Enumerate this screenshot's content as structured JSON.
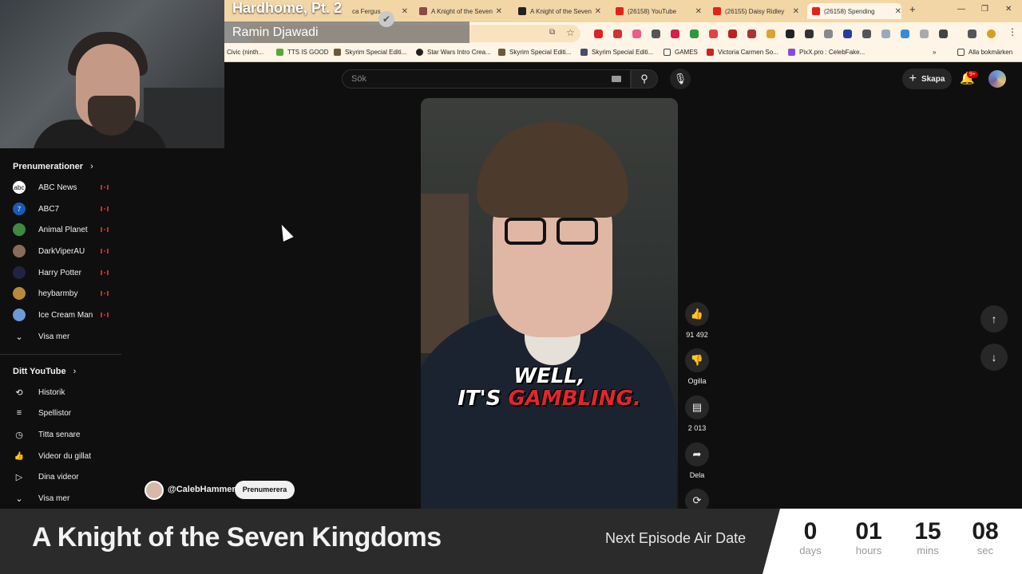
{
  "stream_overlay": {
    "title": "Hardhome, Pt. 2",
    "subtitle": "Ramin Djawadi"
  },
  "browser": {
    "tabs": [
      {
        "label": "ca Fergus"
      },
      {
        "label": "A Knight of the Seven"
      },
      {
        "label": "A Knight of the Seven"
      },
      {
        "label": "(26158) YouTube"
      },
      {
        "label": "(26155) Daisy Ridley"
      },
      {
        "label": "(26158) Spending"
      }
    ],
    "bookmarks": [
      {
        "label": "Civic (ninth..."
      },
      {
        "label": "TTS IS GOOD"
      },
      {
        "label": "Skyrim Special Editi..."
      },
      {
        "label": "Star Wars Intro Crea..."
      },
      {
        "label": "Skyrim Special Editi..."
      },
      {
        "label": "Skyrim Special Editi..."
      },
      {
        "label": "GAMES"
      },
      {
        "label": "Victoria Carmen So..."
      },
      {
        "label": "PixX.pro : CelebFake..."
      },
      {
        "label": "Alla bokmärken"
      }
    ]
  },
  "youtube": {
    "search_placeholder": "Sök",
    "create_label": "Skapa",
    "notif_badge": "9+",
    "subscriptions_heading": "Prenumerationer",
    "subscriptions": [
      {
        "label": "ABC News",
        "color": "#ffffff"
      },
      {
        "label": "ABC7",
        "color": "#1a5bb8"
      },
      {
        "label": "Animal Planet",
        "color": "#3f8a3f"
      },
      {
        "label": "DarkViperAU",
        "color": "#8a6a5a"
      },
      {
        "label": "Harry Potter",
        "color": "#222244"
      },
      {
        "label": "heybarmby",
        "color": "#b88a3a"
      },
      {
        "label": "Ice Cream Man",
        "color": "#6a9ad8"
      }
    ],
    "show_more": "Visa mer",
    "you_heading": "Ditt YouTube",
    "you_items": [
      {
        "label": "Historik",
        "icon": "⟲"
      },
      {
        "label": "Spellistor",
        "icon": "≡"
      },
      {
        "label": "Titta senare",
        "icon": "◷"
      },
      {
        "label": "Videor du gillat",
        "icon": "👍"
      },
      {
        "label": "Dina videor",
        "icon": "▷"
      }
    ],
    "show_more_2": "Visa mer",
    "short": {
      "caption_line1": "WELL,",
      "caption_line2_a": "IT'S ",
      "caption_line2_b": "GAMBLING.",
      "channel": "@CalebHammer",
      "subscribe": "Prenumerera",
      "likes": "91 492",
      "dislike_label": "Ogilla",
      "comments": "2 013",
      "share_label": "Dela"
    }
  },
  "countdown": {
    "show_title": "A Knight of the Seven Kingdoms",
    "label": "Next Episode Air Date",
    "days": "0",
    "days_unit": "days",
    "hours": "01",
    "hours_unit": "hours",
    "mins": "15",
    "mins_unit": "mins",
    "secs": "08",
    "secs_unit": "sec"
  }
}
